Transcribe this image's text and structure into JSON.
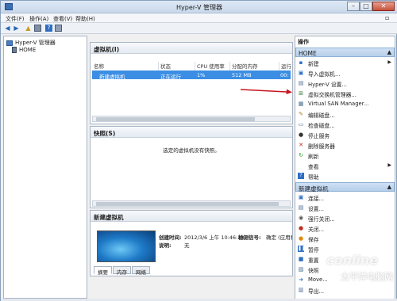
{
  "window": {
    "title": "Hyper-V 管理器"
  },
  "menu": [
    "文件(F)",
    "操作(A)",
    "查看(V)",
    "帮助(H)"
  ],
  "tree": {
    "root": "Hyper-V 管理器",
    "child": "HOME"
  },
  "vm_panel": {
    "title": "虚拟机(I)",
    "columns": [
      "名称",
      "状态",
      "CPU 使用率",
      "分配的内存",
      "运行"
    ],
    "rows": [
      {
        "name": "新建虚拟机",
        "state": "正在运行",
        "cpu": "1%",
        "memory": "512 MB",
        "uptime": "00:"
      }
    ]
  },
  "snapshot_panel": {
    "title": "快照(S)",
    "empty_message": "选定的虚拟机没有快照。"
  },
  "detail_panel": {
    "title": "新建虚拟机",
    "created_label": "创建时间:",
    "created_value": "2012/3/6 上午 10:46:38",
    "notes_label": "说明:",
    "notes_value": "无",
    "heartbeat_label": "检测信号:",
    "heartbeat_value": "确定 (应用程",
    "tabs": [
      "摘要",
      "内存",
      "网络"
    ]
  },
  "actions": {
    "title": "操作",
    "home_header": "HOME",
    "home_items": [
      {
        "label": "新建",
        "icon": "new-icon",
        "submenu": true
      },
      {
        "label": "导入虚拟机...",
        "icon": "import-icon"
      },
      {
        "label": "Hyper-V 设置...",
        "icon": "settings-icon"
      },
      {
        "label": "虚拟交换机管理器...",
        "icon": "switch-icon"
      },
      {
        "label": "Virtual SAN Manager...",
        "icon": "san-icon"
      },
      {
        "label": "编辑磁盘...",
        "icon": "disk-edit-icon"
      },
      {
        "label": "检查磁盘...",
        "icon": "disk-inspect-icon"
      },
      {
        "label": "停止服务",
        "icon": "stop-service-icon"
      },
      {
        "label": "删除服务器",
        "icon": "delete-icon"
      },
      {
        "label": "刷新",
        "icon": "refresh-icon"
      },
      {
        "label": "查看",
        "icon": "view-icon",
        "submenu": true
      },
      {
        "label": "帮助",
        "icon": "help-icon"
      }
    ],
    "vm_header": "新建虚拟机",
    "vm_items": [
      {
        "label": "连接...",
        "icon": "connect-icon"
      },
      {
        "label": "设置...",
        "icon": "vm-settings-icon"
      },
      {
        "label": "强行关闭...",
        "icon": "turn-off-icon"
      },
      {
        "label": "关闭...",
        "icon": "shutdown-icon"
      },
      {
        "label": "保存",
        "icon": "save-icon"
      },
      {
        "label": "暂停",
        "icon": "pause-icon"
      },
      {
        "label": "重置",
        "icon": "reset-icon"
      },
      {
        "label": "快照",
        "icon": "snapshot-icon"
      },
      {
        "label": "Move...",
        "icon": "move-icon"
      },
      {
        "label": "导出...",
        "icon": "export-icon"
      }
    ]
  },
  "watermark": {
    "main": "conline",
    "sub": "太平洋电脑网"
  },
  "colors": {
    "selection": "#3b8ee3",
    "action_header": "#b6cfea",
    "annotation_arrow": "#c8141e"
  }
}
